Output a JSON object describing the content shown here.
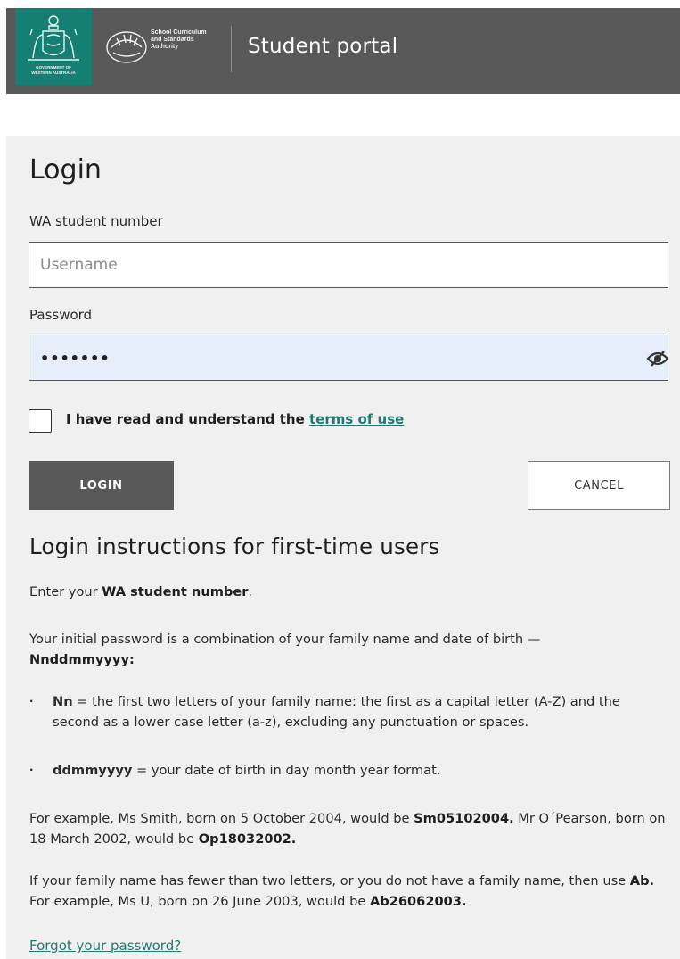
{
  "header": {
    "gov_logo_text": [
      "GOVERNMENT OF",
      "WESTERN AUSTRALIA"
    ],
    "scsa_logo_text": [
      "School Curriculum",
      "and Standards",
      "Authority"
    ],
    "portal_title": "Student portal"
  },
  "login": {
    "title": "Login",
    "student_number_label": "WA student number",
    "username_placeholder": "Username",
    "password_label": "Password",
    "password_value": "passwrd",
    "terms_prefix": "I have read and understand the ",
    "terms_link": "terms of use",
    "login_button": "LOGIN",
    "cancel_button": "CANCEL"
  },
  "instructions": {
    "title": "Login instructions for first-time users",
    "p1_prefix": "Enter your ",
    "p1_bold": "WA student number",
    "p1_suffix": ".",
    "p2_text": "Your initial password is a combination of your family name and date of birth —",
    "p2_bold": "Nnddmmyyyy:",
    "b1_bold": "Nn",
    "b1_text": " = the first two letters of your family name: the first as a capital letter (A-Z) and the second as a lower case letter (a-z), excluding any punctuation or spaces.",
    "b2_bold": "ddmmyyyy",
    "b2_text": " = your date of birth in day month year format.",
    "p3_a": "For example, Ms Smith, born on 5 October 2004, would be ",
    "p3_b": "Sm05102004.",
    "p3_c": " Mr O´Pearson, born on 18 March 2002, would be ",
    "p3_d": "Op18032002.",
    "p4_a": "If your family name has fewer than two letters, or you do not have a family name, then use ",
    "p4_b": "Ab.",
    "p4_c": " For example, Ms U, born on 26 June 2003, would be ",
    "p4_d": "Ab26062003.",
    "forgot_link": "Forgot your password?"
  },
  "colors": {
    "header_bg": "#595959",
    "gov_logo_bg": "#167f74",
    "panel_bg": "#f0f0f0",
    "link": "#1f7a70",
    "password_bg": "#e6edfb"
  }
}
